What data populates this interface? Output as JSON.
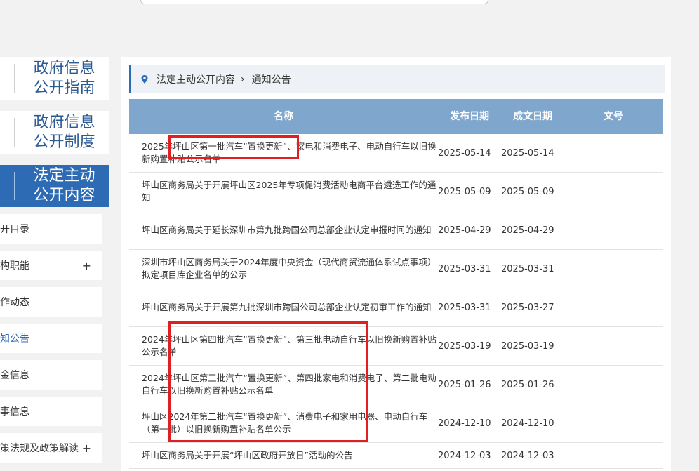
{
  "sidebar": {
    "blocks": [
      {
        "line1": "政府信息",
        "line2": "公开指南"
      },
      {
        "line1": "政府信息",
        "line2": "公开制度"
      },
      {
        "line1": "法定主动",
        "line2": "公开内容"
      }
    ],
    "items": [
      {
        "label": "开目录"
      },
      {
        "label": "构职能",
        "plus": "+"
      },
      {
        "label": "作动态"
      },
      {
        "label": "知公告"
      },
      {
        "label": "金信息"
      },
      {
        "label": "事信息"
      },
      {
        "label": "策法规及政策解读",
        "plus": "+"
      }
    ]
  },
  "breadcrumb": {
    "parent": "法定主动公开内容",
    "separator": "›",
    "current": "通知公告"
  },
  "table": {
    "headers": {
      "name": "名称",
      "publish_date": "发布日期",
      "create_date": "成文日期",
      "doc_no": "文号"
    },
    "rows": [
      {
        "name": "2025年坪山区第一批汽车“置换更新”、家电和消费电子、电动自行车以旧换新购置补贴公示名单",
        "publish": "2025-05-14",
        "created": "2025-05-14",
        "doc": ""
      },
      {
        "name": "坪山区商务局关于开展坪山区2025年专项促消费活动电商平台遴选工作的通知",
        "publish": "2025-05-09",
        "created": "2025-05-09",
        "doc": ""
      },
      {
        "name": "坪山区商务局关于延长深圳市第九批跨国公司总部企业认定申报时间的通知",
        "publish": "2025-04-29",
        "created": "2025-04-29",
        "doc": ""
      },
      {
        "name": "深圳市坪山区商务局关于2024年度中央资金（现代商贸流通体系试点事项）拟定项目库企业名单的公示",
        "publish": "2025-03-31",
        "created": "2025-03-31",
        "doc": ""
      },
      {
        "name": "坪山区商务局关于开展第九批深圳市跨国公司总部企业认定初审工作的通知",
        "publish": "2025-03-31",
        "created": "2025-03-27",
        "doc": ""
      },
      {
        "name": "2024年坪山区第四批汽车“置换更新”、第三批电动自行车以旧换新购置补贴公示名单",
        "publish": "2025-03-19",
        "created": "2025-03-19",
        "doc": ""
      },
      {
        "name": "2024年坪山区第三批汽车“置换更新”、第四批家电和消费电子、第二批电动自行车以旧换新购置补贴公示名单",
        "publish": "2025-01-26",
        "created": "2025-01-26",
        "doc": ""
      },
      {
        "name": "坪山区2024年第二批汽车“置换更新”、消费电子和家用电器、电动自行车（第一批）以旧换新购置补贴名单公示",
        "publish": "2024-12-10",
        "created": "2024-12-10",
        "doc": ""
      },
      {
        "name": "坪山区商务局关于开展“坪山区政府开放日”活动的公告",
        "publish": "2024-12-03",
        "created": "2024-12-03",
        "doc": ""
      }
    ]
  },
  "colors": {
    "accent": "#2d6bb5",
    "table_header": "#7fa6cc",
    "highlight": "#e02020"
  }
}
